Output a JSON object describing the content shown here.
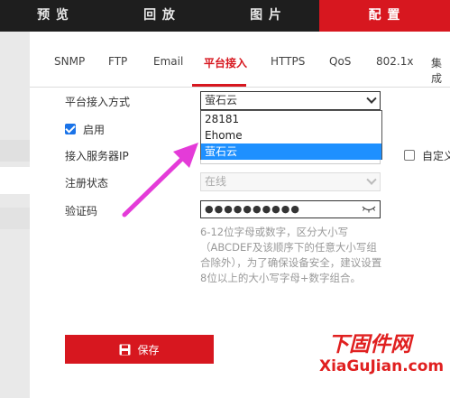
{
  "topnav": {
    "items": [
      {
        "label": "预 览"
      },
      {
        "label": "回 放"
      },
      {
        "label": "图 片"
      },
      {
        "label": "配 置"
      }
    ]
  },
  "tabs": [
    {
      "label": "SNMP"
    },
    {
      "label": "FTP"
    },
    {
      "label": "Email"
    },
    {
      "label": "平台接入"
    },
    {
      "label": "HTTPS"
    },
    {
      "label": "QoS"
    },
    {
      "label": "802.1x"
    },
    {
      "label": "集成"
    }
  ],
  "form": {
    "access_mode_label": "平台接入方式",
    "access_mode_value": "萤石云",
    "access_mode_options": [
      "28181",
      "Ehome",
      "萤石云"
    ],
    "enable_label": "启用",
    "server_ip_label": "接入服务器IP",
    "custom_label": "自定义",
    "register_status_label": "注册状态",
    "register_status_value": "在线",
    "verify_code_label": "验证码",
    "verify_code_value": "●●●●●●●●●●",
    "hint": "6-12位字母或数字，区分大小写（ABCDEF及该顺序下的任意大小写组合除外），为了确保设备安全，建议设置8位以上的大小写字母+数字组合。"
  },
  "save_label": "保存",
  "watermark": {
    "cn": "下固件网",
    "en": "XiaGuJian.com"
  },
  "colors": {
    "accent": "#d7171f",
    "selected_option": "#1e90ff",
    "arrow": "#e43bd8"
  }
}
